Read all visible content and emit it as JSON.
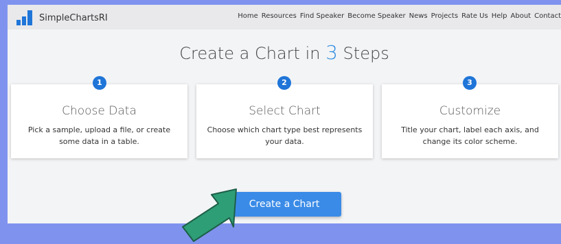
{
  "brand": {
    "name": "SimpleChartsRI",
    "accent_color": "#1f75d8"
  },
  "nav": {
    "items": [
      "Home",
      "Resources",
      "Find Speaker",
      "Become Speaker",
      "News",
      "Projects",
      "Rate Us",
      "Help",
      "About",
      "Contact"
    ]
  },
  "heading": {
    "prefix": "Create a Chart in ",
    "number": "3",
    "suffix": " Steps"
  },
  "steps": [
    {
      "number": "1",
      "title": "Choose Data",
      "text": "Pick a sample, upload a file, or create some data in a table."
    },
    {
      "number": "2",
      "title": "Select Chart",
      "text": "Choose which chart type best represents your data."
    },
    {
      "number": "3",
      "title": "Customize",
      "text": "Title your chart, label each axis, and change its color scheme."
    }
  ],
  "cta": {
    "label": "Create a Chart",
    "color": "#3a8be7"
  },
  "annotation": {
    "icon": "green-arrow-icon",
    "color": "#2e9e76"
  }
}
